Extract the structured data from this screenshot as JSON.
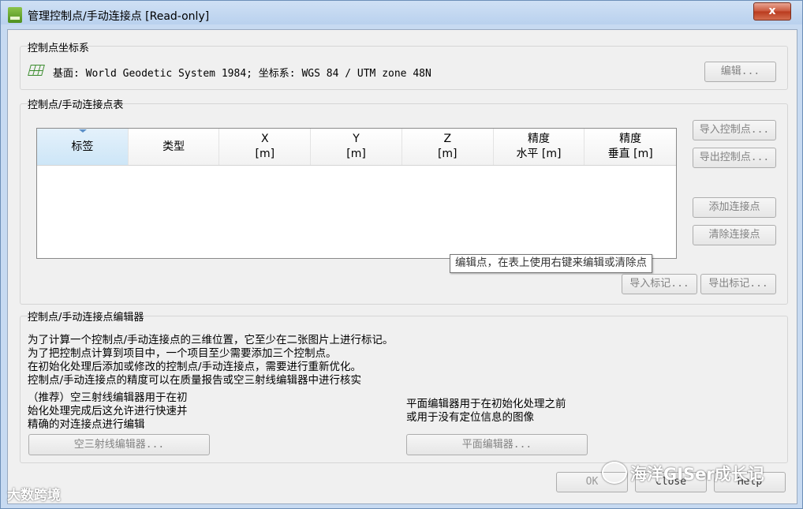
{
  "window": {
    "title": "管理控制点/手动连接点 [Read-only]",
    "close_glyph": "x"
  },
  "coord_system": {
    "section_label": "控制点坐标系",
    "text": "基面: World Geodetic System 1984; 坐标系: WGS 84 / UTM zone 48N",
    "edit_button": "编辑..."
  },
  "gcp_table": {
    "section_label": "控制点/手动连接点表",
    "columns": [
      {
        "line1": "标签",
        "line2": ""
      },
      {
        "line1": "类型",
        "line2": ""
      },
      {
        "line1": "X",
        "line2": "[m]"
      },
      {
        "line1": "Y",
        "line2": "[m]"
      },
      {
        "line1": "Z",
        "line2": "[m]"
      },
      {
        "line1": "精度",
        "line2": "水平 [m]"
      },
      {
        "line1": "精度",
        "line2": "垂直 [m]"
      }
    ],
    "tooltip": "编辑点，在表上使用右键来编辑或清除点",
    "buttons": {
      "import_gcp": "导入控制点...",
      "export_gcp": "导出控制点...",
      "add_tie": "添加连接点",
      "clear_tie": "清除连接点",
      "import_marks": "导入标记...",
      "export_marks": "导出标记..."
    }
  },
  "editor": {
    "section_label": "控制点/手动连接点编辑器",
    "lines": [
      "为了计算一个控制点/手动连接点的三维位置，它至少在二张图片上进行标记。",
      "为了把控制点计算到项目中，一个项目至少需要添加三个控制点。",
      "在初始化处理后添加或修改的控制点/手动连接点，需要进行重新优化。",
      "控制点/手动连接点的精度可以在质量报告或空三射线编辑器中进行核实"
    ],
    "ray_desc": [
      "（推荐）空三射线编辑器用于在初",
      "始化处理完成后这允许进行快速并",
      "精确的对连接点进行编辑"
    ],
    "plane_desc": [
      "平面编辑器用于在初始化处理之前",
      "或用于没有定位信息的图像"
    ],
    "ray_button": "空三射线编辑器...",
    "plane_button": "平面编辑器..."
  },
  "footer": {
    "ok": "OK",
    "close": "Close",
    "help": "Help"
  },
  "watermarks": {
    "left": "大数跨境",
    "right": "海洋GISer成长记"
  }
}
